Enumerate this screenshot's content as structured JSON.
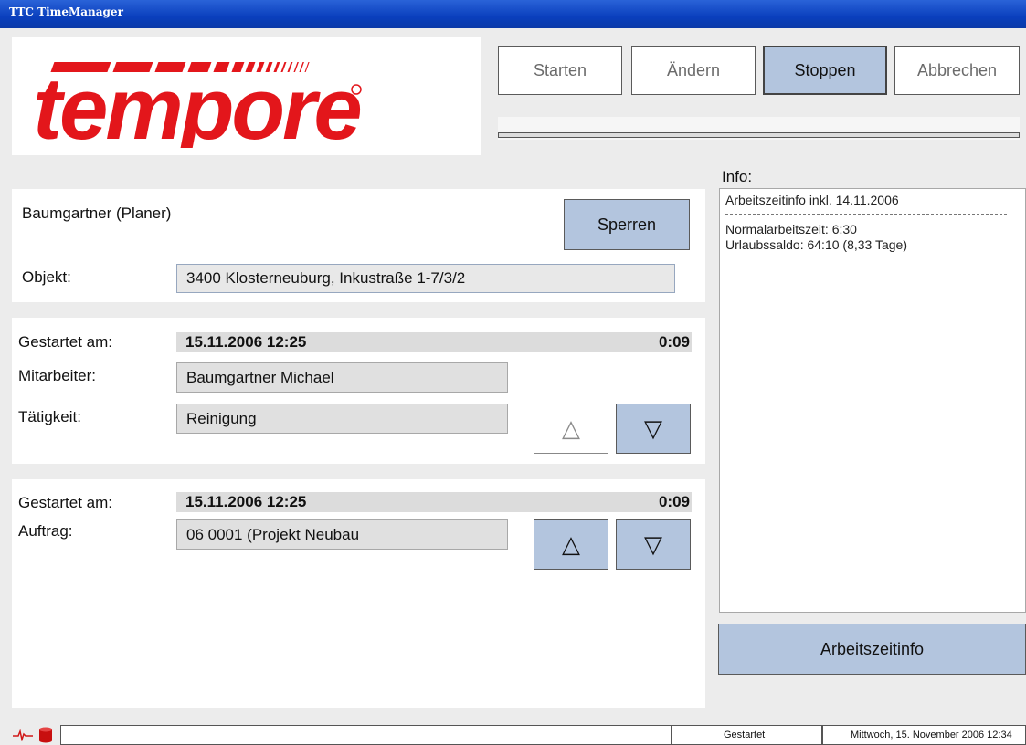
{
  "window": {
    "title": "TTC TimeManager"
  },
  "logo": {
    "text": "tempore"
  },
  "toolbar": {
    "start": "Starten",
    "edit": "Ändern",
    "stop": "Stoppen",
    "cancel": "Abbrechen"
  },
  "header": {
    "user": "Baumgartner (Planer)",
    "lock_button": "Sperren",
    "object_label": "Objekt:",
    "object_value": "3400 Klosterneuburg, Inkustraße 1-7/3/2"
  },
  "activity_block": {
    "started_label": "Gestartet am:",
    "started_value": "15.11.2006 12:25",
    "duration": "0:09",
    "employee_label": "Mitarbeiter:",
    "employee_value": "Baumgartner Michael",
    "activity_label": "Tätigkeit:",
    "activity_value": "Reinigung"
  },
  "order_block": {
    "started_label": "Gestartet am:",
    "started_value": "15.11.2006 12:25",
    "duration": "0:09",
    "order_label": "Auftrag:",
    "order_value": "06 0001 (Projekt Neubau"
  },
  "info": {
    "title": "Info:",
    "line1": "Arbeitszeitinfo inkl. 14.11.2006",
    "line2": "Normalarbeitszeit: 6:30",
    "line3": "Urlaubssaldo: 64:10 (8,33 Tage)",
    "button": "Arbeitszeitinfo"
  },
  "status": {
    "message": "",
    "state": "Gestartet",
    "datetime": "Mittwoch, 15. November 2006 12:34"
  },
  "icons": {
    "up": "up-triangle-icon",
    "down": "down-triangle-icon",
    "heartbeat": "heartbeat-icon",
    "database": "database-icon"
  },
  "colors": {
    "accent": "#b3c5de",
    "logo_red": "#e3161b",
    "titlebar": "#0a3fbd"
  }
}
